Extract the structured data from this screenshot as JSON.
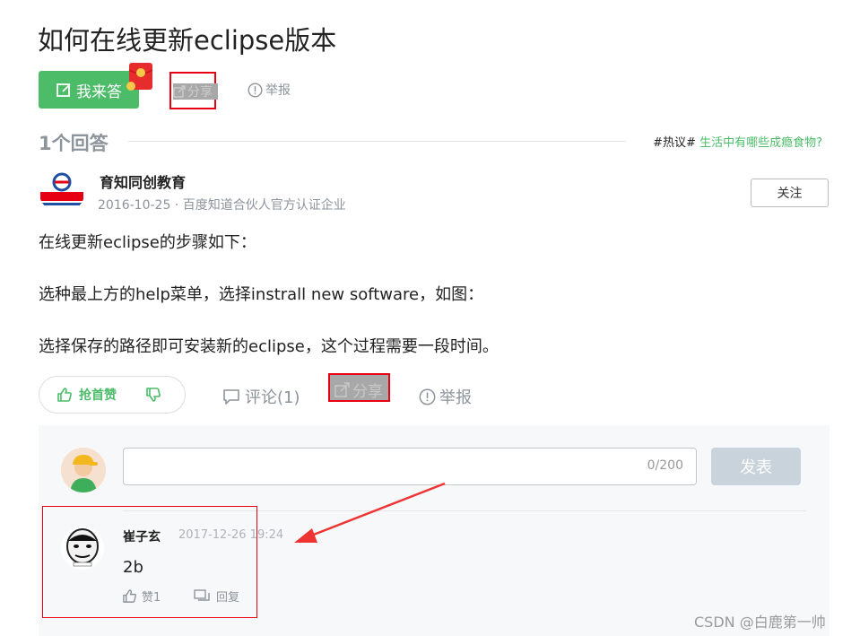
{
  "question": {
    "title": "如何在线更新eclipse版本",
    "answer_button": "我来答",
    "share_label": "分享",
    "report_label": "举报"
  },
  "answers_header": {
    "count_label": "1个回答",
    "hot_tag": "#热议#",
    "hot_link": "生活中有哪些成瘾食物?"
  },
  "answer": {
    "author": "育知同创教育",
    "date": "2016-10-25",
    "meta": "百度知道合伙人官方认证企业",
    "follow_label": "关注",
    "paragraphs": [
      "在线更新eclipse的步骤如下：",
      "选种最上方的help菜单，选择instrall new software，如图：",
      "选择保存的路径即可安装新的eclipse，这个过程需要一段时间。"
    ],
    "vote_up_label": "抢首赞",
    "comment_label": "评论(1)",
    "share_label": "分享",
    "report_label": "举报"
  },
  "comment_form": {
    "char_count": "0/200",
    "publish_label": "发表"
  },
  "comment": {
    "user": "崔子玄",
    "time": "2017-12-26 19:24",
    "text": "2b",
    "like_label": "赞1",
    "reply_label": "回复"
  },
  "watermark": "CSDN @白鹿第一帅",
  "colors": {
    "accent_green": "#4cbc69",
    "highlight_red": "#e60012",
    "muted_text": "#8d949c",
    "panel_bg": "#f7f8f9"
  },
  "icons": [
    "edit-icon",
    "red-packet-icon",
    "share-icon",
    "report-icon",
    "thumb-up-icon",
    "thumb-down-icon",
    "comment-icon",
    "reply-icon"
  ]
}
